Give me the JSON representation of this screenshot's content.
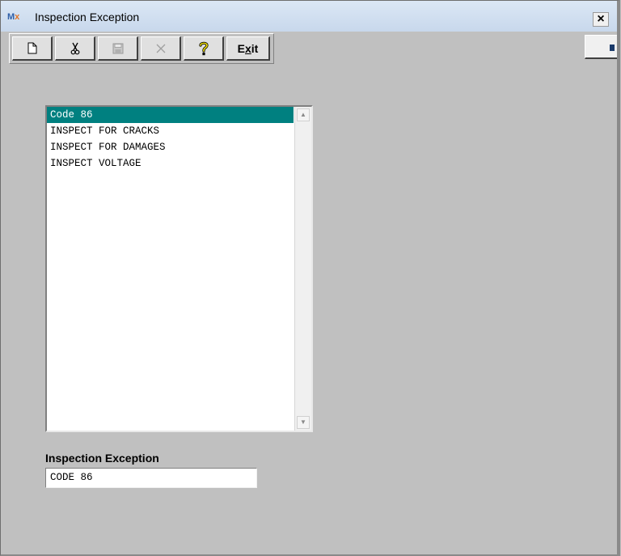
{
  "window": {
    "title": "Inspection Exception",
    "logo_text_m": "M",
    "logo_text_x": "x",
    "close_label": "×"
  },
  "toolbar": {
    "buttons": [
      {
        "name": "new",
        "icon": "new-document-icon",
        "enabled": true
      },
      {
        "name": "cut",
        "icon": "scissors-icon",
        "enabled": true
      },
      {
        "name": "save",
        "icon": "floppy-disk-icon",
        "enabled": false
      },
      {
        "name": "delete",
        "icon": "x-icon",
        "enabled": false
      },
      {
        "name": "help",
        "icon": "question-icon",
        "enabled": true
      }
    ],
    "exit_label_prefix": "E",
    "exit_label_underlined": "x",
    "exit_label_suffix": "it"
  },
  "list": {
    "items": [
      "Code 86",
      "INSPECT FOR CRACKS",
      "INSPECT FOR DAMAGES",
      "INSPECT VOLTAGE"
    ],
    "selected_index": 0
  },
  "form": {
    "label": "Inspection Exception",
    "value": "CODE 86"
  },
  "colors": {
    "selection": "#008080",
    "background": "#c0c0c0"
  }
}
